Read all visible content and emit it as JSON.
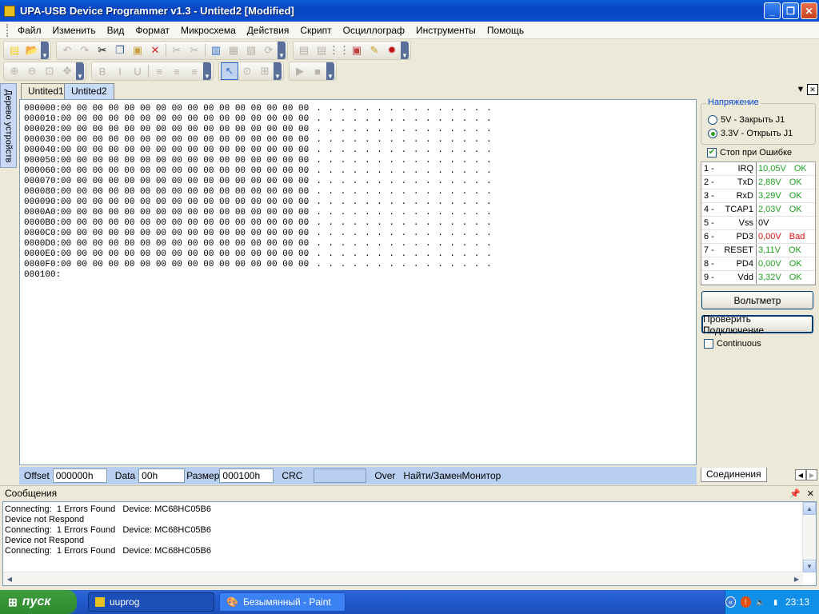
{
  "window": {
    "title": "UPA-USB Device Programmer v1.3 - Untited2 [Modified]",
    "minimize": "_",
    "maximize": "❐",
    "close": "✕"
  },
  "menu": [
    "Файл",
    "Изменить",
    "Вид",
    "Формат",
    "Микросхема",
    "Действия",
    "Скрипт",
    "Осциллограф",
    "Инструменты",
    "Помощь"
  ],
  "sidebar_tab": "Дерево устройств",
  "doc_tabs": [
    "Untited1",
    "Untited2"
  ],
  "hex_rows": [
    {
      "addr": "000000:",
      "bytes": "00 00 00 00 00 00 00 00 00 00 00 00 00 00 00 00",
      "ascii": ". . . . . . . . . . . . . . . ."
    },
    {
      "addr": "000010:",
      "bytes": "00 00 00 00 00 00 00 00 00 00 00 00 00 00 00 00",
      "ascii": ". . . . . . . . . . . . . . . ."
    },
    {
      "addr": "000020:",
      "bytes": "00 00 00 00 00 00 00 00 00 00 00 00 00 00 00 00",
      "ascii": ". . . . . . . . . . . . . . . ."
    },
    {
      "addr": "000030:",
      "bytes": "00 00 00 00 00 00 00 00 00 00 00 00 00 00 00 00",
      "ascii": ". . . . . . . . . . . . . . . ."
    },
    {
      "addr": "000040:",
      "bytes": "00 00 00 00 00 00 00 00 00 00 00 00 00 00 00 00",
      "ascii": ". . . . . . . . . . . . . . . ."
    },
    {
      "addr": "000050:",
      "bytes": "00 00 00 00 00 00 00 00 00 00 00 00 00 00 00 00",
      "ascii": ". . . . . . . . . . . . . . . ."
    },
    {
      "addr": "000060:",
      "bytes": "00 00 00 00 00 00 00 00 00 00 00 00 00 00 00 00",
      "ascii": ". . . . . . . . . . . . . . . ."
    },
    {
      "addr": "000070:",
      "bytes": "00 00 00 00 00 00 00 00 00 00 00 00 00 00 00 00",
      "ascii": ". . . . . . . . . . . . . . . ."
    },
    {
      "addr": "000080:",
      "bytes": "00 00 00 00 00 00 00 00 00 00 00 00 00 00 00 00",
      "ascii": ". . . . . . . . . . . . . . . ."
    },
    {
      "addr": "000090:",
      "bytes": "00 00 00 00 00 00 00 00 00 00 00 00 00 00 00 00",
      "ascii": ". . . . . . . . . . . . . . . ."
    },
    {
      "addr": "0000A0:",
      "bytes": "00 00 00 00 00 00 00 00 00 00 00 00 00 00 00 00",
      "ascii": ". . . . . . . . . . . . . . . ."
    },
    {
      "addr": "0000B0:",
      "bytes": "00 00 00 00 00 00 00 00 00 00 00 00 00 00 00 00",
      "ascii": ". . . . . . . . . . . . . . . ."
    },
    {
      "addr": "0000C0:",
      "bytes": "00 00 00 00 00 00 00 00 00 00 00 00 00 00 00 00",
      "ascii": ". . . . . . . . . . . . . . . ."
    },
    {
      "addr": "0000D0:",
      "bytes": "00 00 00 00 00 00 00 00 00 00 00 00 00 00 00 00",
      "ascii": ". . . . . . . . . . . . . . . ."
    },
    {
      "addr": "0000E0:",
      "bytes": "00 00 00 00 00 00 00 00 00 00 00 00 00 00 00 00",
      "ascii": ". . . . . . . . . . . . . . . ."
    },
    {
      "addr": "0000F0:",
      "bytes": "00 00 00 00 00 00 00 00 00 00 00 00 00 00 00 00",
      "ascii": ". . . . . . . . . . . . . . . ."
    },
    {
      "addr": "000100:",
      "bytes": "",
      "ascii": ""
    }
  ],
  "statusbar": {
    "offset_label": "Offset",
    "offset_value": "000000h",
    "data_label": "Data",
    "data_value": "00h",
    "size_label": "Размер",
    "size_value": "000100h",
    "crc_label": "CRC",
    "crc_value": "",
    "over": "Over",
    "find_replace": "Найти/Замен",
    "monitor": "Монитор"
  },
  "voltage": {
    "legend": "Напряжение",
    "option_5v": "5V - Закрыть J1",
    "option_33v": "3.3V - Открыть J1",
    "stop_on_error": "Стоп при Ошибке"
  },
  "pins": [
    {
      "num": "1 -",
      "name": "IRQ",
      "value": "10,05V",
      "status": "OK",
      "kind": "ok"
    },
    {
      "num": "2 -",
      "name": "TxD",
      "value": "2,88V",
      "status": "OK",
      "kind": "ok"
    },
    {
      "num": "3 -",
      "name": "RxD",
      "value": "3,29V",
      "status": "OK",
      "kind": "ok"
    },
    {
      "num": "4 -",
      "name": "TCAP1",
      "value": "2,03V",
      "status": "OK",
      "kind": "ok"
    },
    {
      "num": "5 -",
      "name": "Vss",
      "value": "0V",
      "status": "",
      "kind": "plain"
    },
    {
      "num": "6 -",
      "name": "PD3",
      "value": "0,00V",
      "status": "Bad",
      "kind": "bad"
    },
    {
      "num": "7 -",
      "name": "RESET",
      "value": "3,11V",
      "status": "OK",
      "kind": "ok"
    },
    {
      "num": "8 -",
      "name": "PD4",
      "value": "0,00V",
      "status": "OK",
      "kind": "ok"
    },
    {
      "num": "9 -",
      "name": "Vdd",
      "value": "3,32V",
      "status": "OK",
      "kind": "ok"
    }
  ],
  "buttons": {
    "voltmeter": "Вольтметр",
    "check_connection": "Проверить Подключение",
    "continuous": "Continuous"
  },
  "right_tab": "Соединения",
  "messages": {
    "title": "Сообщения",
    "lines": [
      "Connecting:  1 Errors Found   Device: MC68HC05B6",
      "Device not Respond",
      "Connecting:  1 Errors Found   Device: MC68HC05B6",
      "Device not Respond",
      "Connecting:  1 Errors Found   Device: MC68HC05B6"
    ]
  },
  "taskbar": {
    "start": "пуск",
    "tasks": [
      "uuprog",
      "Безымянный - Paint"
    ],
    "clock": "23:13"
  },
  "colors": {
    "ok": "#21a121",
    "bad": "#e01010",
    "accent": "#0a5fd8"
  }
}
